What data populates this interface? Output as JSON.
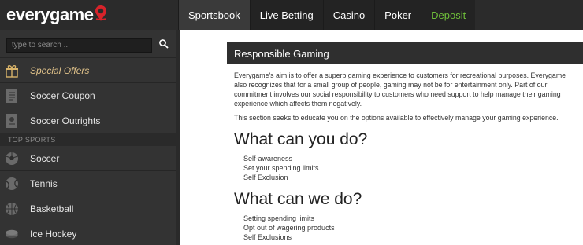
{
  "header": {
    "logo_text": "everygame",
    "nav": [
      {
        "label": "Sportsbook",
        "active": true
      },
      {
        "label": "Live Betting"
      },
      {
        "label": "Casino"
      },
      {
        "label": "Poker"
      },
      {
        "label": "Deposit",
        "color": "#6fbf3a"
      }
    ]
  },
  "sidebar": {
    "search_placeholder": "type to search ...",
    "items_top": [
      {
        "label": "Special Offers",
        "icon": "gift-icon"
      },
      {
        "label": "Soccer Coupon",
        "icon": "coupon-icon"
      },
      {
        "label": "Soccer Outrights",
        "icon": "outrights-icon"
      }
    ],
    "section_label": "TOP SPORTS",
    "items_sports": [
      {
        "label": "Soccer",
        "icon": "soccer-ball-icon"
      },
      {
        "label": "Tennis",
        "icon": "tennis-ball-icon"
      },
      {
        "label": "Basketball",
        "icon": "basketball-icon"
      },
      {
        "label": "Ice Hockey",
        "icon": "hockey-puck-icon"
      }
    ]
  },
  "content": {
    "title": "Responsible Gaming",
    "intro": "Everygame's aim is to offer a superb gaming experience to customers for recreational purposes. Everygame also recognizes that for a small group of people, gaming may not be for entertainment only. Part of our commitment involves our social responsibility to customers who need support to help manage their gaming experience which affects them negatively.",
    "intro2": "This section seeks to educate you on the options available to effectively manage your gaming experience.",
    "heading1": "What can you do?",
    "list1": [
      "Self-awareness",
      "Set your spending limits",
      "Self Exclusion"
    ],
    "heading2": "What can we do?",
    "list2": [
      "Setting spending limits",
      "Opt out of wagering products",
      "Self Exclusions"
    ]
  },
  "colors": {
    "header_bg": "#2b2b2b",
    "sidebar_bg": "#333333",
    "deposit_green": "#6fbf3a",
    "logo_pin_red": "#d8232a",
    "special_offers_gold": "#e0c28a"
  }
}
